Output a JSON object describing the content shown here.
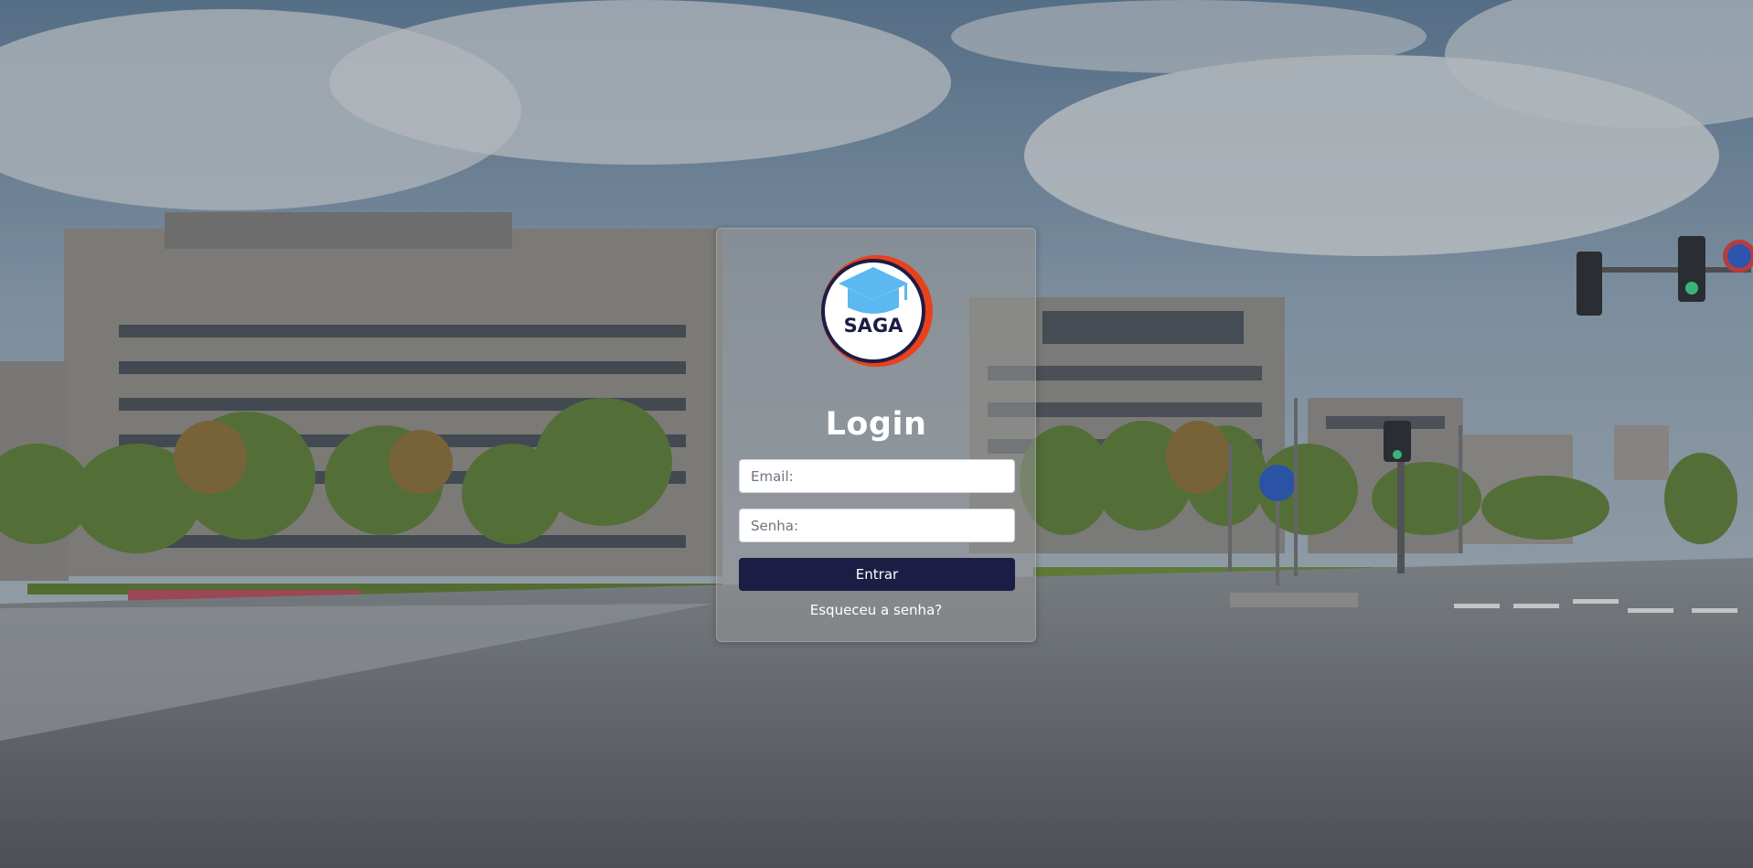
{
  "background": {
    "description_icon": "campus-building-photo-icon"
  },
  "logo": {
    "text": "SAGA",
    "icon": "graduation-cap-icon",
    "colors": {
      "ring_outer": "#e8411c",
      "ring_inner": "#1c1d45",
      "cap": "#5bb8f0",
      "text": "#1c1d45"
    }
  },
  "login": {
    "title": "Login",
    "email_placeholder": "Email:",
    "senha_placeholder": "Senha:",
    "submit_label": "Entrar",
    "forgot_label": "Esqueceu a senha?"
  },
  "colors": {
    "button_bg": "#1c1d45",
    "button_text": "#ffffff"
  }
}
